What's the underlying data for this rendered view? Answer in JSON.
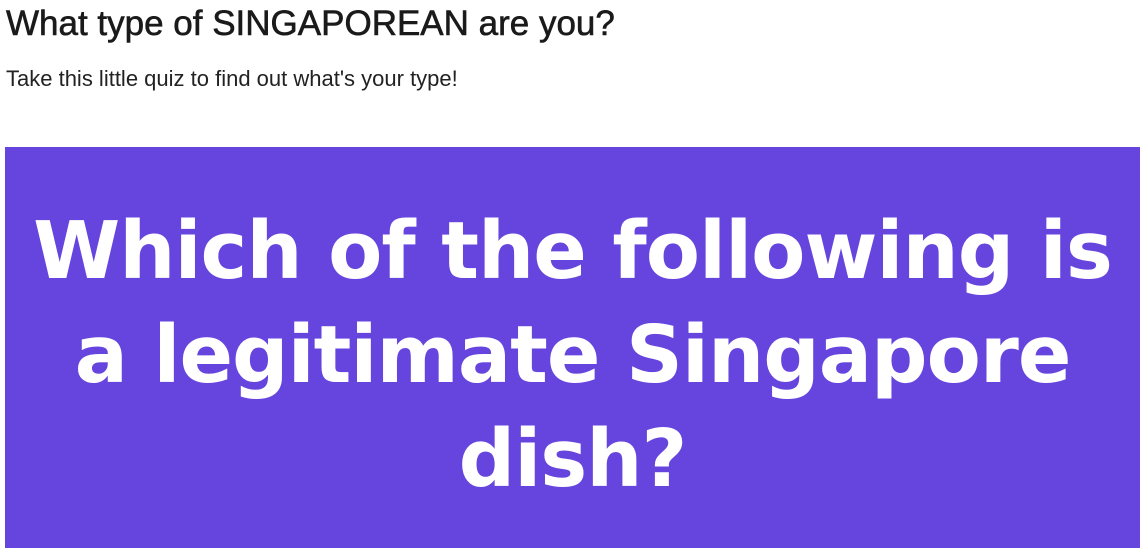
{
  "quiz": {
    "title": "What type of SINGAPOREAN are you?",
    "subtitle": "Take this little quiz to find out what's your type!"
  },
  "question": {
    "text": "Which of the following is a legitimate Singapore dish?",
    "background_color": "#6645df",
    "text_color": "#ffffff"
  }
}
